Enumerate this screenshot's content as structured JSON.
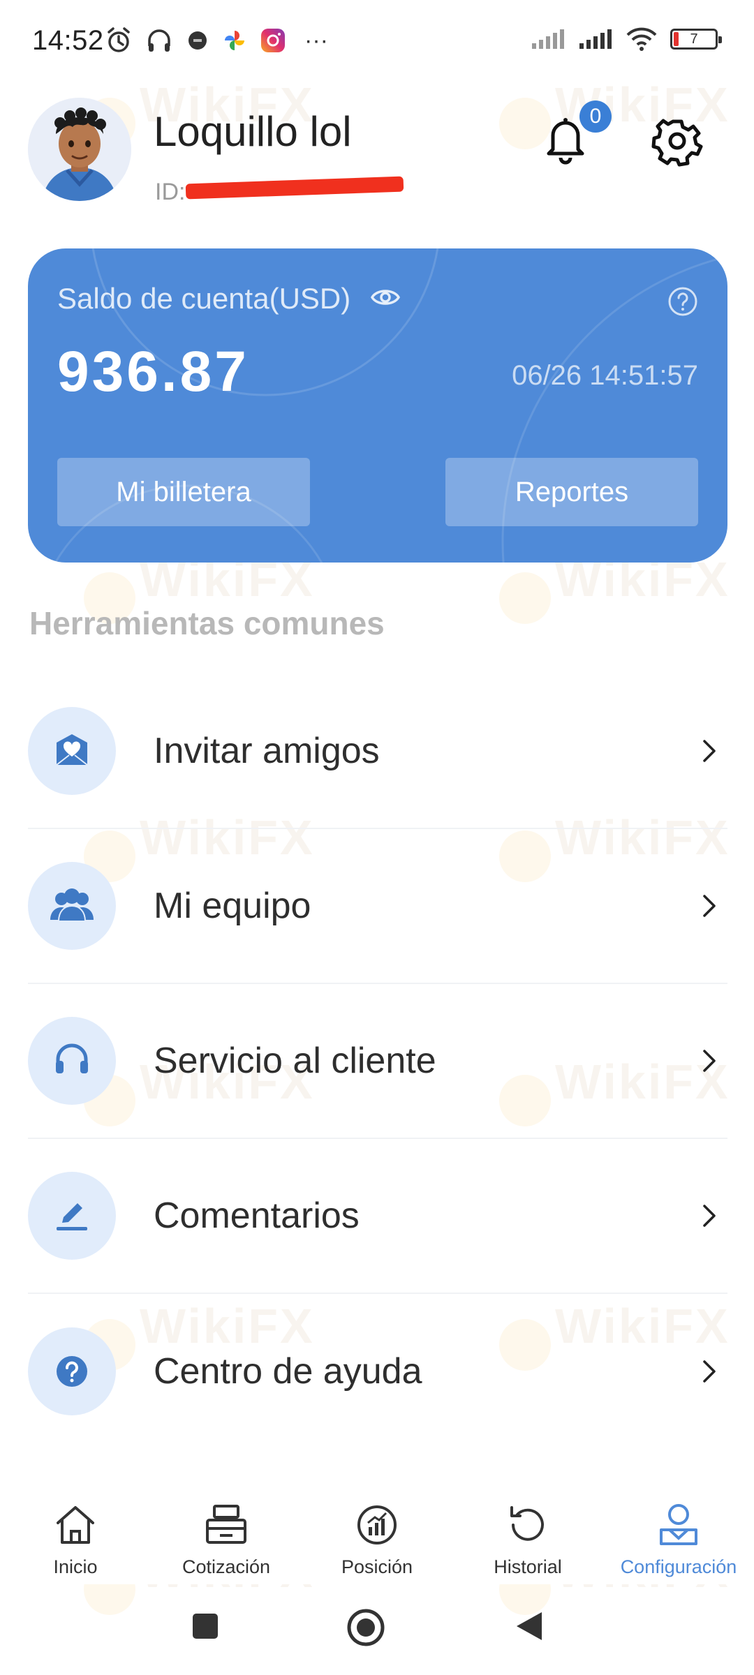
{
  "status_bar": {
    "time": "14:52",
    "battery_level": "7",
    "more_indicator": "···",
    "icons_left": [
      "alarm-icon",
      "headphones-icon",
      "dot-icon",
      "pinwheel-icon",
      "instagram-icon"
    ],
    "icons_right": [
      "signal-icon",
      "signal-icon",
      "wifi-icon",
      "battery-icon"
    ]
  },
  "profile": {
    "name": "Loquillo lol",
    "id_label": "ID:",
    "notification_count": "0"
  },
  "balance_card": {
    "title": "Saldo de cuenta(USD)",
    "balance": "936.87",
    "timestamp": "06/26 14:51:57",
    "wallet_button": "Mi billetera",
    "reports_button": "Reportes",
    "card_color": "#4f8ad8"
  },
  "tools": {
    "section_title": "Herramientas comunes",
    "items": [
      {
        "label": "Invitar amigos",
        "icon": "invite-icon"
      },
      {
        "label": "Mi equipo",
        "icon": "team-icon"
      },
      {
        "label": "Servicio al cliente",
        "icon": "headset-icon"
      },
      {
        "label": "Comentarios",
        "icon": "pen-icon"
      },
      {
        "label": "Centro de ayuda",
        "icon": "help-icon"
      }
    ]
  },
  "bottom_nav": {
    "items": [
      {
        "label": "Inicio",
        "icon": "home-icon"
      },
      {
        "label": "Cotización",
        "icon": "register-icon"
      },
      {
        "label": "Posición",
        "icon": "position-chart-icon"
      },
      {
        "label": "Historial",
        "icon": "history-icon"
      },
      {
        "label": "Configuración",
        "icon": "profile-icon"
      }
    ],
    "active": "Configuración",
    "active_color": "#4f8ad8"
  },
  "watermark": {
    "text": "WikiFX"
  }
}
